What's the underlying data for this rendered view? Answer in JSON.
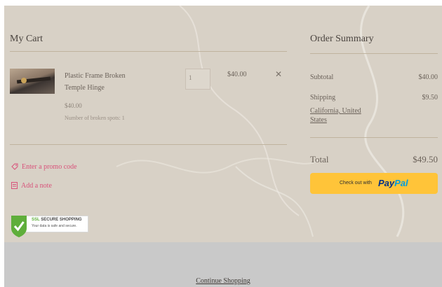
{
  "cart": {
    "title": "My Cart",
    "items": [
      {
        "name": "Plastic Frame Broken Temple Hinge",
        "unit_price": "$40.00",
        "detail": "Number of broken spots: 1",
        "quantity": "1",
        "line_total": "$40.00",
        "remove_symbol": "✕"
      }
    ],
    "promo_label": "Enter a promo code",
    "note_label": "Add a note",
    "promo_icon": "tag-icon",
    "note_icon": "note-icon"
  },
  "ssl_badge": {
    "title_prefix": "SSL",
    "title_rest": "SECURE SHOPPING",
    "subtitle": "Your data is safe and secure.",
    "icon": "check-shield-icon"
  },
  "summary": {
    "title": "Order Summary",
    "subtotal_label": "Subtotal",
    "subtotal_value": "$40.00",
    "shipping_label": "Shipping",
    "shipping_value": "$9.50",
    "shipping_destination": "California, United States",
    "total_label": "Total",
    "total_value": "$49.50",
    "checkout_prefix": "Check out with",
    "paypal_part1": "Pay",
    "paypal_part2": "Pal"
  },
  "footer": {
    "continue_label": "Continue Shopping"
  },
  "colors": {
    "accent_pink": "#d9527a",
    "paypal_yellow": "#ffc439",
    "background": "#d8d1c6"
  }
}
